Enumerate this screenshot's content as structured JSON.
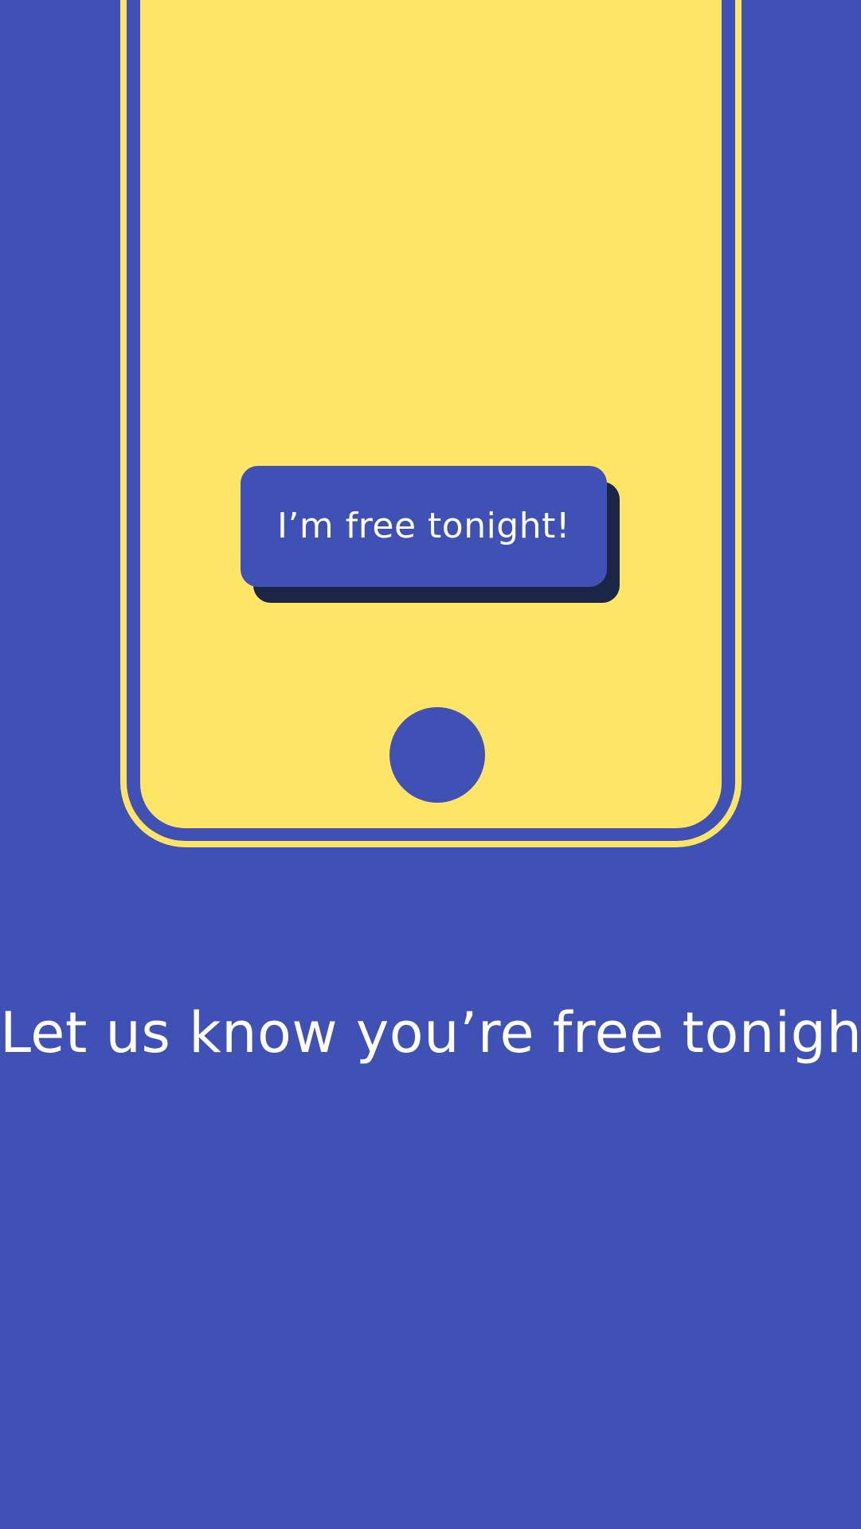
{
  "colors": {
    "background": "#3F51B5",
    "phone_frame": "#FFE566",
    "button": "#3F51B5",
    "button_shadow": "#1A2548",
    "text": "#FFFFFF"
  },
  "phone": {
    "cta_button_label": "I’m free tonight!",
    "home_button_icon": "circle-home-button"
  },
  "headline": "Let us know you’re free tonight"
}
